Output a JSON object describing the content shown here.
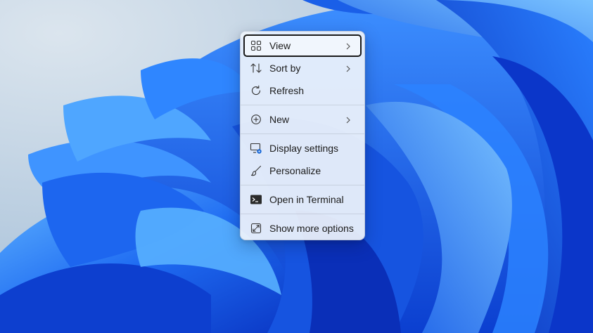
{
  "desktop": {
    "colors": {
      "background": "#b9ccdf",
      "bloom_dark": "#0a3fd6",
      "bloom_mid": "#1f6cf2",
      "bloom_light": "#4aa3ff"
    }
  },
  "context_menu": {
    "items": [
      {
        "label": "View",
        "icon": "grid-icon",
        "submenu": true,
        "focused": true
      },
      {
        "label": "Sort by",
        "icon": "sort-arrows-icon",
        "submenu": true
      },
      {
        "label": "Refresh",
        "icon": "refresh-icon",
        "submenu": false
      },
      {
        "label": "New",
        "icon": "plus-circle-icon",
        "submenu": true
      },
      {
        "label": "Display settings",
        "icon": "display-settings-icon",
        "submenu": false
      },
      {
        "label": "Personalize",
        "icon": "brush-icon",
        "submenu": false
      },
      {
        "label": "Open in Terminal",
        "icon": "terminal-icon",
        "submenu": false
      },
      {
        "label": "Show more options",
        "icon": "expand-icon",
        "submenu": false
      }
    ]
  }
}
